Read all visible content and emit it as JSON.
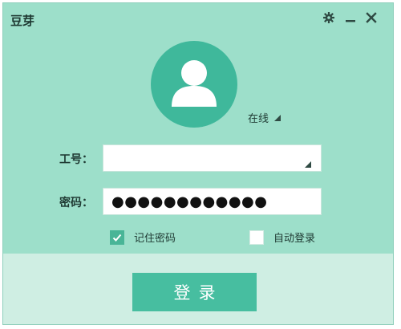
{
  "window": {
    "title": "豆芽",
    "controls": {
      "settings_icon": "gear-icon",
      "minimize_icon": "minimize-icon",
      "close_icon": "close-icon"
    }
  },
  "avatar": {
    "icon": "user-silhouette-icon"
  },
  "status": {
    "label": "在线",
    "icon": "triangle-down-icon"
  },
  "form": {
    "employee_id": {
      "label": "工号：",
      "value": ""
    },
    "password": {
      "label": "密码：",
      "masked_value": "●●●●●●●●●●●●"
    },
    "remember_password": {
      "label": "记住密码",
      "checked": true
    },
    "auto_login": {
      "label": "自动登录",
      "checked": false
    }
  },
  "login_button": {
    "label": "登录"
  },
  "colors": {
    "background": "#9ddfca",
    "accent": "#3fb89b",
    "button": "#47bea0",
    "footer": "#cfeee3"
  }
}
